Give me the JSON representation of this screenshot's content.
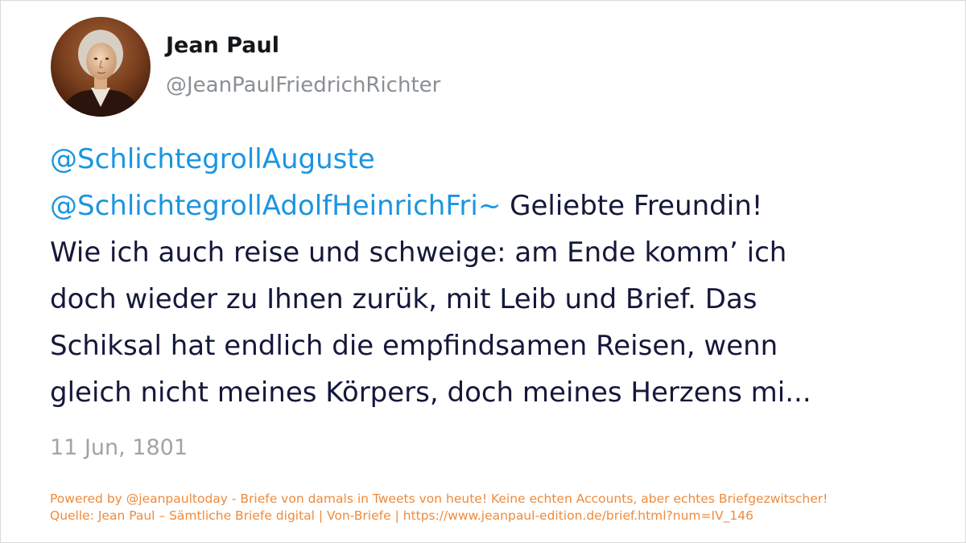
{
  "author": {
    "display_name": "Jean Paul",
    "handle": "@JeanPaulFriedrichRichter",
    "avatar_icon": "portrait-avatar"
  },
  "tweet": {
    "mention_1": "@SchlichtegrollAuguste",
    "mention_2": "@SchlichtegrollAdolfHeinrichFri~",
    "line_2_text": " Geliebte Freundin!",
    "line_3": "Wie ich auch reise und schweige: am Ende komm’ ich",
    "line_4": "doch wieder zu Ihnen zurük, mit Leib und Brief. Das",
    "line_5": "Schiksal hat endlich die empfindsamen Reisen, wenn",
    "line_6": "gleich nicht meines Körpers, doch meines Herzens mi..."
  },
  "date": "11 Jun, 1801",
  "footer": {
    "line_1": "Powered by @jeanpaultoday - Briefe von damals in Tweets von heute! Keine echten Accounts, aber echtes Briefgezwitscher!",
    "line_2": "Quelle: Jean Paul – Sämtliche Briefe digital | Von-Briefe | https://www.jeanpaul-edition.de/brief.html?num=IV_146"
  },
  "colors": {
    "mention": "#1b95e0",
    "body_text": "#14183a",
    "muted": "#a0a4a8",
    "footer": "#f08a3a"
  }
}
